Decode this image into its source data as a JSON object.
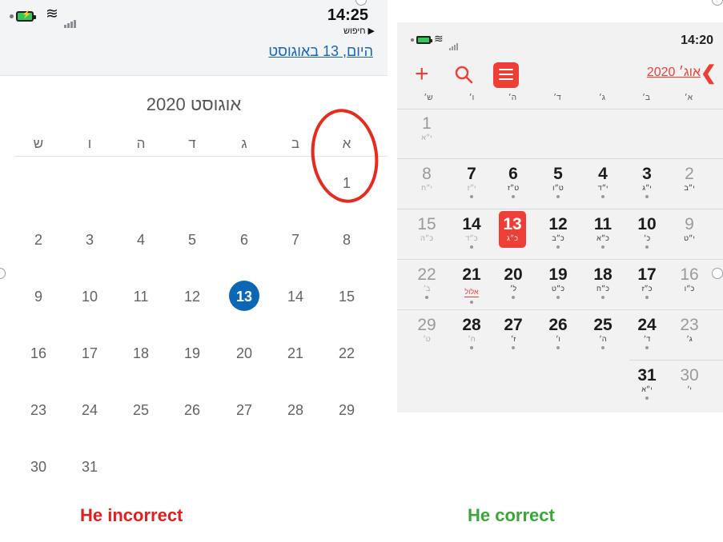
{
  "left": {
    "status": {
      "time": "14:25",
      "back_label": "חיפוש ▶",
      "today_link": "היום, 13 באוגוסט",
      "battery_glyph": "⚡"
    },
    "month_title": "אוגוסט 2020",
    "weekdays": [
      "ש",
      "ו",
      "ה",
      "ד",
      "ג",
      "ב",
      "א"
    ],
    "days": [
      "1",
      "2",
      "3",
      "4",
      "5",
      "6",
      "7",
      "8",
      "9",
      "10",
      "11",
      "12",
      "13",
      "14",
      "15",
      "16",
      "17",
      "18",
      "19",
      "20",
      "21",
      "22",
      "23",
      "24",
      "25",
      "26",
      "27",
      "28",
      "29",
      "30",
      "31"
    ],
    "selected_day": "13",
    "caption": "He incorrect",
    "annotation_color": "#e8291c"
  },
  "right": {
    "status": {
      "time": "14:20"
    },
    "toolbar": {
      "add_label": "+",
      "month_label": "אוג׳ 2020",
      "back_chevron": "❮"
    },
    "weekdays": [
      "ש׳",
      "ו׳",
      "ה׳",
      "ד׳",
      "ג׳",
      "ב׳",
      "א׳"
    ],
    "days": [
      {
        "num": "1",
        "heb": "י״א"
      },
      {
        "num": "2",
        "heb": "י״ב"
      },
      {
        "num": "3",
        "heb": "י״ג"
      },
      {
        "num": "4",
        "heb": "י״ד"
      },
      {
        "num": "5",
        "heb": "ט״ו"
      },
      {
        "num": "6",
        "heb": "ט״ז"
      },
      {
        "num": "7",
        "heb": "י״ז"
      },
      {
        "num": "8",
        "heb": "י״ח"
      },
      {
        "num": "9",
        "heb": "י״ט"
      },
      {
        "num": "10",
        "heb": "כ׳"
      },
      {
        "num": "11",
        "heb": "כ״א"
      },
      {
        "num": "12",
        "heb": "כ״ב"
      },
      {
        "num": "13",
        "heb": "כ״ג"
      },
      {
        "num": "14",
        "heb": "כ״ד"
      },
      {
        "num": "15",
        "heb": "כ״ה"
      },
      {
        "num": "16",
        "heb": "כ״ו"
      },
      {
        "num": "17",
        "heb": "כ״ז"
      },
      {
        "num": "18",
        "heb": "כ״ח"
      },
      {
        "num": "19",
        "heb": "כ״ט"
      },
      {
        "num": "20",
        "heb": "ל׳"
      },
      {
        "num": "21",
        "heb": "אלול"
      },
      {
        "num": "22",
        "heb": "ב׳"
      },
      {
        "num": "23",
        "heb": "ג׳"
      },
      {
        "num": "24",
        "heb": "ד׳"
      },
      {
        "num": "25",
        "heb": "ה׳"
      },
      {
        "num": "26",
        "heb": "ו׳"
      },
      {
        "num": "27",
        "heb": "ז׳"
      },
      {
        "num": "28",
        "heb": "ח׳"
      },
      {
        "num": "29",
        "heb": "ט׳"
      },
      {
        "num": "30",
        "heb": "י׳"
      },
      {
        "num": "31",
        "heb": "י״א"
      }
    ],
    "today_day": "13",
    "accent_color": "#ef3e36",
    "caption": "He correct"
  }
}
